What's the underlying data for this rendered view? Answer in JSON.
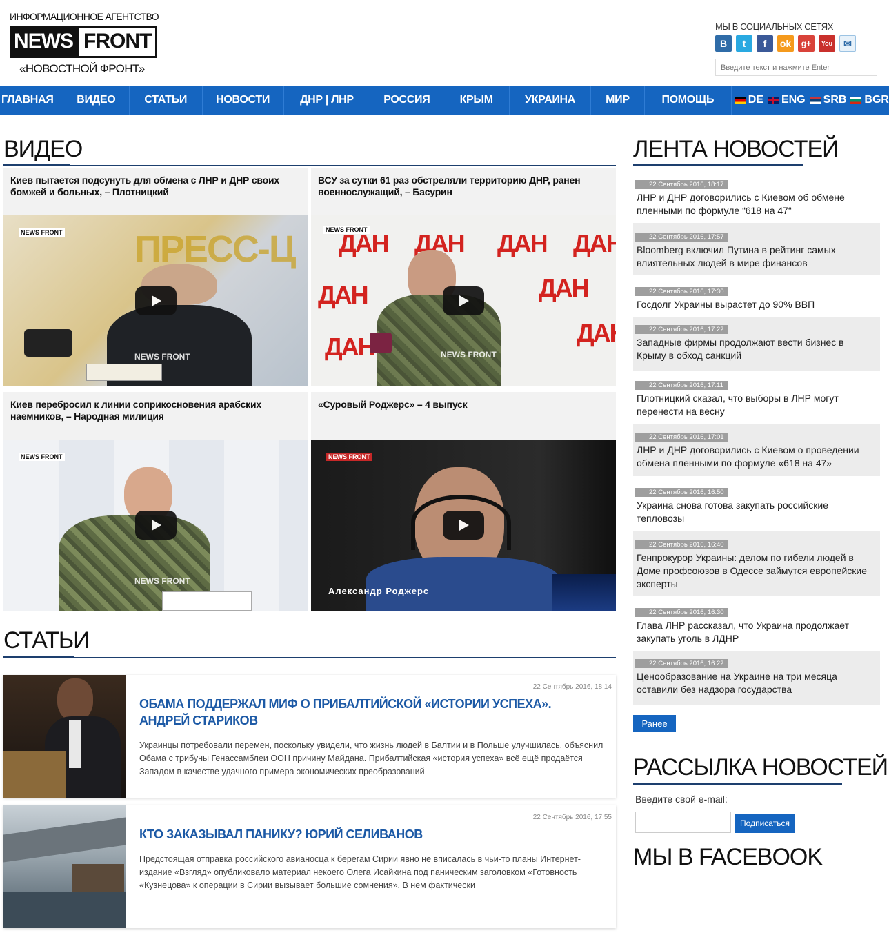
{
  "header": {
    "agency": "ИНФОРМАЦИОННОЕ АГЕНТСТВО",
    "logo_left": "NEWS",
    "logo_right": "FRONT",
    "slogan": "«НОВОСТНОЙ ФРОНТ»",
    "social_title": "МЫ В СОЦИАЛЬНЫХ СЕТЯХ",
    "social": [
      {
        "label": "B",
        "color": "#2f6ca8",
        "icon": "vk-icon"
      },
      {
        "label": "t",
        "color": "#29a9e1",
        "icon": "twitter-icon"
      },
      {
        "label": "f",
        "color": "#3b5998",
        "icon": "facebook-icon"
      },
      {
        "label": "ok",
        "color": "#f59a1c",
        "icon": "odnoklassniki-icon"
      },
      {
        "label": "g+",
        "color": "#d9433a",
        "icon": "googleplus-icon"
      },
      {
        "label": "You",
        "color": "#c9302c",
        "icon": "youtube-icon"
      },
      {
        "label": "✉",
        "color": "#4aa3d8",
        "icon": "livejournal-icon"
      }
    ],
    "search_placeholder": "Введите текст и нажмите Enter"
  },
  "nav": {
    "items": [
      "ГЛАВНАЯ",
      "ВИДЕО",
      "СТАТЬИ",
      "НОВОСТИ",
      "ДНР | ЛНР",
      "РОССИЯ",
      "КРЫМ",
      "УКРАИНА",
      "МИР",
      "ПОМОЩЬ"
    ],
    "langs": [
      "DE",
      "ENG",
      "SRB",
      "BGR"
    ]
  },
  "videos": {
    "title": "ВИДЕО",
    "items": [
      {
        "title": "Киев пытается подсунуть для обмена с ЛНР и ДНР своих бомжей и больных, – Плотницкий"
      },
      {
        "title": "ВСУ за сутки 61 раз обстреляли территорию ДНР, ранен военнослужащий, – Басурин"
      },
      {
        "title": "Киев перебросил к линии соприкосновения арабских наемников, – Народная милиция"
      },
      {
        "title": "«Суровый Роджерс» – 4 выпуск"
      }
    ],
    "thumb_texts": {
      "press": "ПРЕСС-Ц",
      "dan": "ДАН",
      "name_caption": "Александр Роджерс",
      "wm": "NEWS FRONT"
    }
  },
  "articles": {
    "title": "СТАТЬИ",
    "items": [
      {
        "date": "22 Сентябрь 2016, 18:14",
        "title": "ОБАМА ПОДДЕРЖАЛ МИФ О ПРИБАЛТИЙСКОЙ «ИСТОРИИ УСПЕХА». АНДРЕЙ СТАРИКОВ",
        "text": "Украинцы потребовали перемен, поскольку увидели, что жизнь людей в Балтии и в Польше улучшилась, объяснил Обама с трибуны Генассамблеи ООН причину Майдана. Прибалтийская «история успеха» всё ещё продаётся Западом в качестве удачного примера экономических преобразований"
      },
      {
        "date": "22 Сентябрь 2016, 17:55",
        "title": "КТО ЗАКАЗЫВАЛ ПАНИКУ? ЮРИЙ СЕЛИВАНОВ",
        "text": "Предстоящая отправка российского авианосца к берегам Сирии явно не вписалась в чьи-то планы Интернет-издание «Взгляд» опубликовало материал некоего Олега Исайкина под паническим заголовком «Готовность «Кузнецова» к операции в Сирии вызывает большие сомнения». В нем фактически"
      }
    ]
  },
  "sidebar": {
    "news_title": "ЛЕНТА НОВОСТЕЙ",
    "news": [
      {
        "date": "22 Сентябрь 2016, 18:17",
        "text": "ЛНР и ДНР договорились с Киевом об обмене пленными по формуле “618 на 47“"
      },
      {
        "date": "22 Сентябрь 2016, 17:57",
        "text": "Bloomberg включил Путина в рейтинг самых влиятельных людей в мире финансов"
      },
      {
        "date": "22 Сентябрь 2016, 17:30",
        "text": "Госдолг Украины вырастет до 90% ВВП"
      },
      {
        "date": "22 Сентябрь 2016, 17:22",
        "text": "Западные фирмы продолжают вести бизнес в Крыму в обход санкций"
      },
      {
        "date": "22 Сентябрь 2016, 17:11",
        "text": "Плотницкий сказал, что выборы в ЛНР могут перенести на весну"
      },
      {
        "date": "22 Сентябрь 2016, 17:01",
        "text": "ЛНР и ДНР договорились с Киевом о проведении обмена пленными по формуле «618 на 47»"
      },
      {
        "date": "22 Сентябрь 2016, 16:50",
        "text": "Украина снова готова закупать российские тепловозы"
      },
      {
        "date": "22 Сентябрь 2016, 16:40",
        "text": "Генпрокурор Украины: делом по гибели людей в Доме профсоюзов в Одессе займутся европейские эксперты"
      },
      {
        "date": "22 Сентябрь 2016, 16:30",
        "text": "Глава ЛНР рассказал, что Украина продолжает закупать уголь в ЛДНР"
      },
      {
        "date": "22 Сентябрь 2016, 16:22",
        "text": "Ценообразование на Украине на три месяца оставили без надзора государства"
      }
    ],
    "more_label": "Ранее",
    "newsletter_title": "РАССЫЛКА НОВОСТЕЙ",
    "email_label": "Введите свой e-mail:",
    "subscribe_label": "Подписаться",
    "facebook_title": "МЫ В FACEBOOK"
  }
}
